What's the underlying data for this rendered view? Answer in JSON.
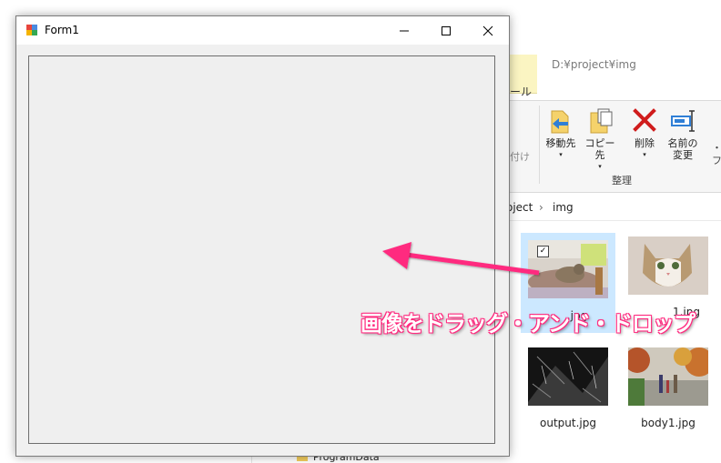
{
  "explorer": {
    "title_path": "D:¥project¥img",
    "tool_tab_label": "ール",
    "ribbon": {
      "clipped_left_label": "付け",
      "move_to": "移動先",
      "copy_to": "コピー先",
      "delete": "削除",
      "rename_line1": "名前の",
      "rename_line2": "変更",
      "clipped_right_label": "フ",
      "group_label": "整理"
    },
    "breadcrumb": {
      "parent": "oject",
      "separator": "›",
      "current": "img"
    },
    "files": [
      {
        "name": "cat.jpg",
        "selected": true,
        "checked": true,
        "visible_name": ".jpg"
      },
      {
        "name": "cat1.jpg",
        "selected": false,
        "visible_name": "1.jpg"
      },
      {
        "name": "output.jpg",
        "selected": false,
        "visible_name": "output.jpg"
      },
      {
        "name": "body1.jpg",
        "selected": false,
        "visible_name": "body1.jpg"
      }
    ],
    "nav_item": "ProgramData"
  },
  "form1": {
    "title": "Form1"
  },
  "annotation": {
    "caption": "画像をドラッグ・アンド・ドロップ",
    "color": "#ff2a7f"
  }
}
